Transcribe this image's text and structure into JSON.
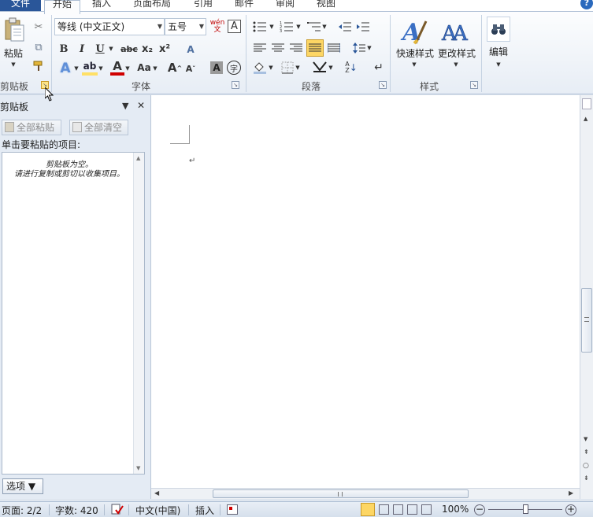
{
  "tabs": [
    {
      "label": "文件"
    },
    {
      "label": "开始"
    },
    {
      "label": "插入"
    },
    {
      "label": "页面布局"
    },
    {
      "label": "引用"
    },
    {
      "label": "邮件"
    },
    {
      "label": "审阅"
    },
    {
      "label": "视图"
    }
  ],
  "help_glyph": "?",
  "ribbon": {
    "clipboard": {
      "group_label": "剪贴板",
      "paste_label": "粘贴",
      "cut_glyph": "✂",
      "copy_glyph": "⧉",
      "painter_glyph": "🖌"
    },
    "font": {
      "group_label": "字体",
      "font_name": "等线 (中文正文)",
      "font_size": "五号",
      "wen_glyph": "wén\n文",
      "a_box": "A",
      "bold": "B",
      "italic": "I",
      "underline": "U",
      "strike": "abc",
      "sub": "x₂",
      "sup": "x²",
      "clear_glyph": "A",
      "effects": "A",
      "highlight": "ab",
      "color": "A",
      "case": "Aa",
      "grow": "A",
      "shrink": "A",
      "shade": "A",
      "circle": "字"
    },
    "paragraph": {
      "group_label": "段落",
      "sort_glyph": "A\nZ",
      "mark_glyph": "↵"
    },
    "styles": {
      "group_label": "样式",
      "quick_label": "快速样式",
      "change_label": "更改样式"
    },
    "editing": {
      "label": "编辑"
    }
  },
  "pane": {
    "title": "剪贴板",
    "paste_all": "全部粘贴",
    "clear_all": "全部清空",
    "prompt": "单击要粘贴的项目:",
    "empty_message": "剪贴板为空。\n请进行复制或剪切以收集项目。",
    "options": "选项 ▼",
    "close_glyph": "✕",
    "menu_glyph": "▼"
  },
  "document": {
    "paragraph_mark": "↵"
  },
  "status": {
    "page": "页面: 2/2",
    "words": "字数: 420",
    "language": "中文(中国)",
    "mode": "插入",
    "zoom": "100%"
  },
  "colors": {
    "accent": "#2a5699",
    "highlight": "#ffe066",
    "font_color": "#d00000",
    "selected_button": "#fdd664"
  }
}
